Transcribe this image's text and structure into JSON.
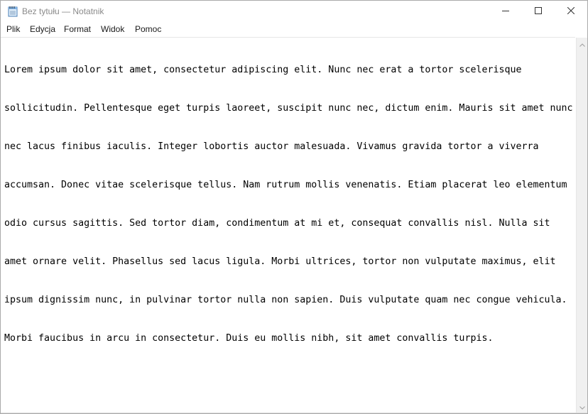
{
  "window": {
    "title": "Bez tytułu — Notatnik",
    "app_icon": "notepad-icon"
  },
  "caption_buttons": {
    "minimize_icon": "minimize-icon",
    "maximize_icon": "maximize-icon",
    "close_icon": "close-icon"
  },
  "menu": {
    "items": [
      {
        "label": "Plik"
      },
      {
        "label": "Edycja"
      },
      {
        "label": "Format"
      },
      {
        "label": "Widok"
      },
      {
        "label": "Pomoc"
      }
    ]
  },
  "editor": {
    "lines": [
      "Lorem ipsum dolor sit amet, consectetur adipiscing elit. Nunc nec erat a tortor scelerisque",
      "sollicitudin. Pellentesque eget turpis laoreet, suscipit nunc nec, dictum enim. Mauris sit amet nunc",
      "nec lacus finibus iaculis. Integer lobortis auctor malesuada. Vivamus gravida tortor a viverra",
      "accumsan. Donec vitae scelerisque tellus. Nam rutrum mollis venenatis. Etiam placerat leo elementum",
      "odio cursus sagittis. Sed tortor diam, condimentum at mi et, consequat convallis nisl. Nulla sit",
      "amet ornare velit. Phasellus sed lacus ligula. Morbi ultrices, tortor non vulputate maximus, elit",
      "ipsum dignissim nunc, in pulvinar tortor nulla non sapien. Duis vulputate quam nec congue vehicula.",
      "Morbi faucibus in arcu in consectetur. Duis eu mollis nibh, sit amet convallis turpis."
    ]
  },
  "scrollbar": {
    "up_icon": "scroll-up-arrow-icon",
    "down_icon": "scroll-down-arrow-icon"
  }
}
